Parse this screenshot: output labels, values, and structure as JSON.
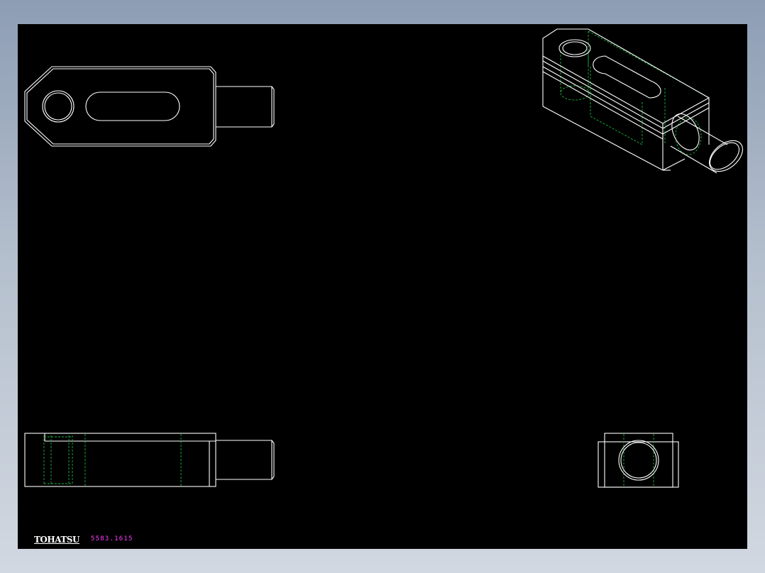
{
  "drawing": {
    "brand_text": "TOHATSU",
    "part_number": "5583.1615",
    "colors": {
      "background_outer": "#9aa8bd",
      "canvas": "#000000",
      "line_visible": "#ffffff",
      "line_hidden": "#19b33c",
      "part_number_text": "#ff3cff"
    },
    "views": [
      "top-view",
      "isometric-view",
      "front-view",
      "side-view"
    ]
  }
}
